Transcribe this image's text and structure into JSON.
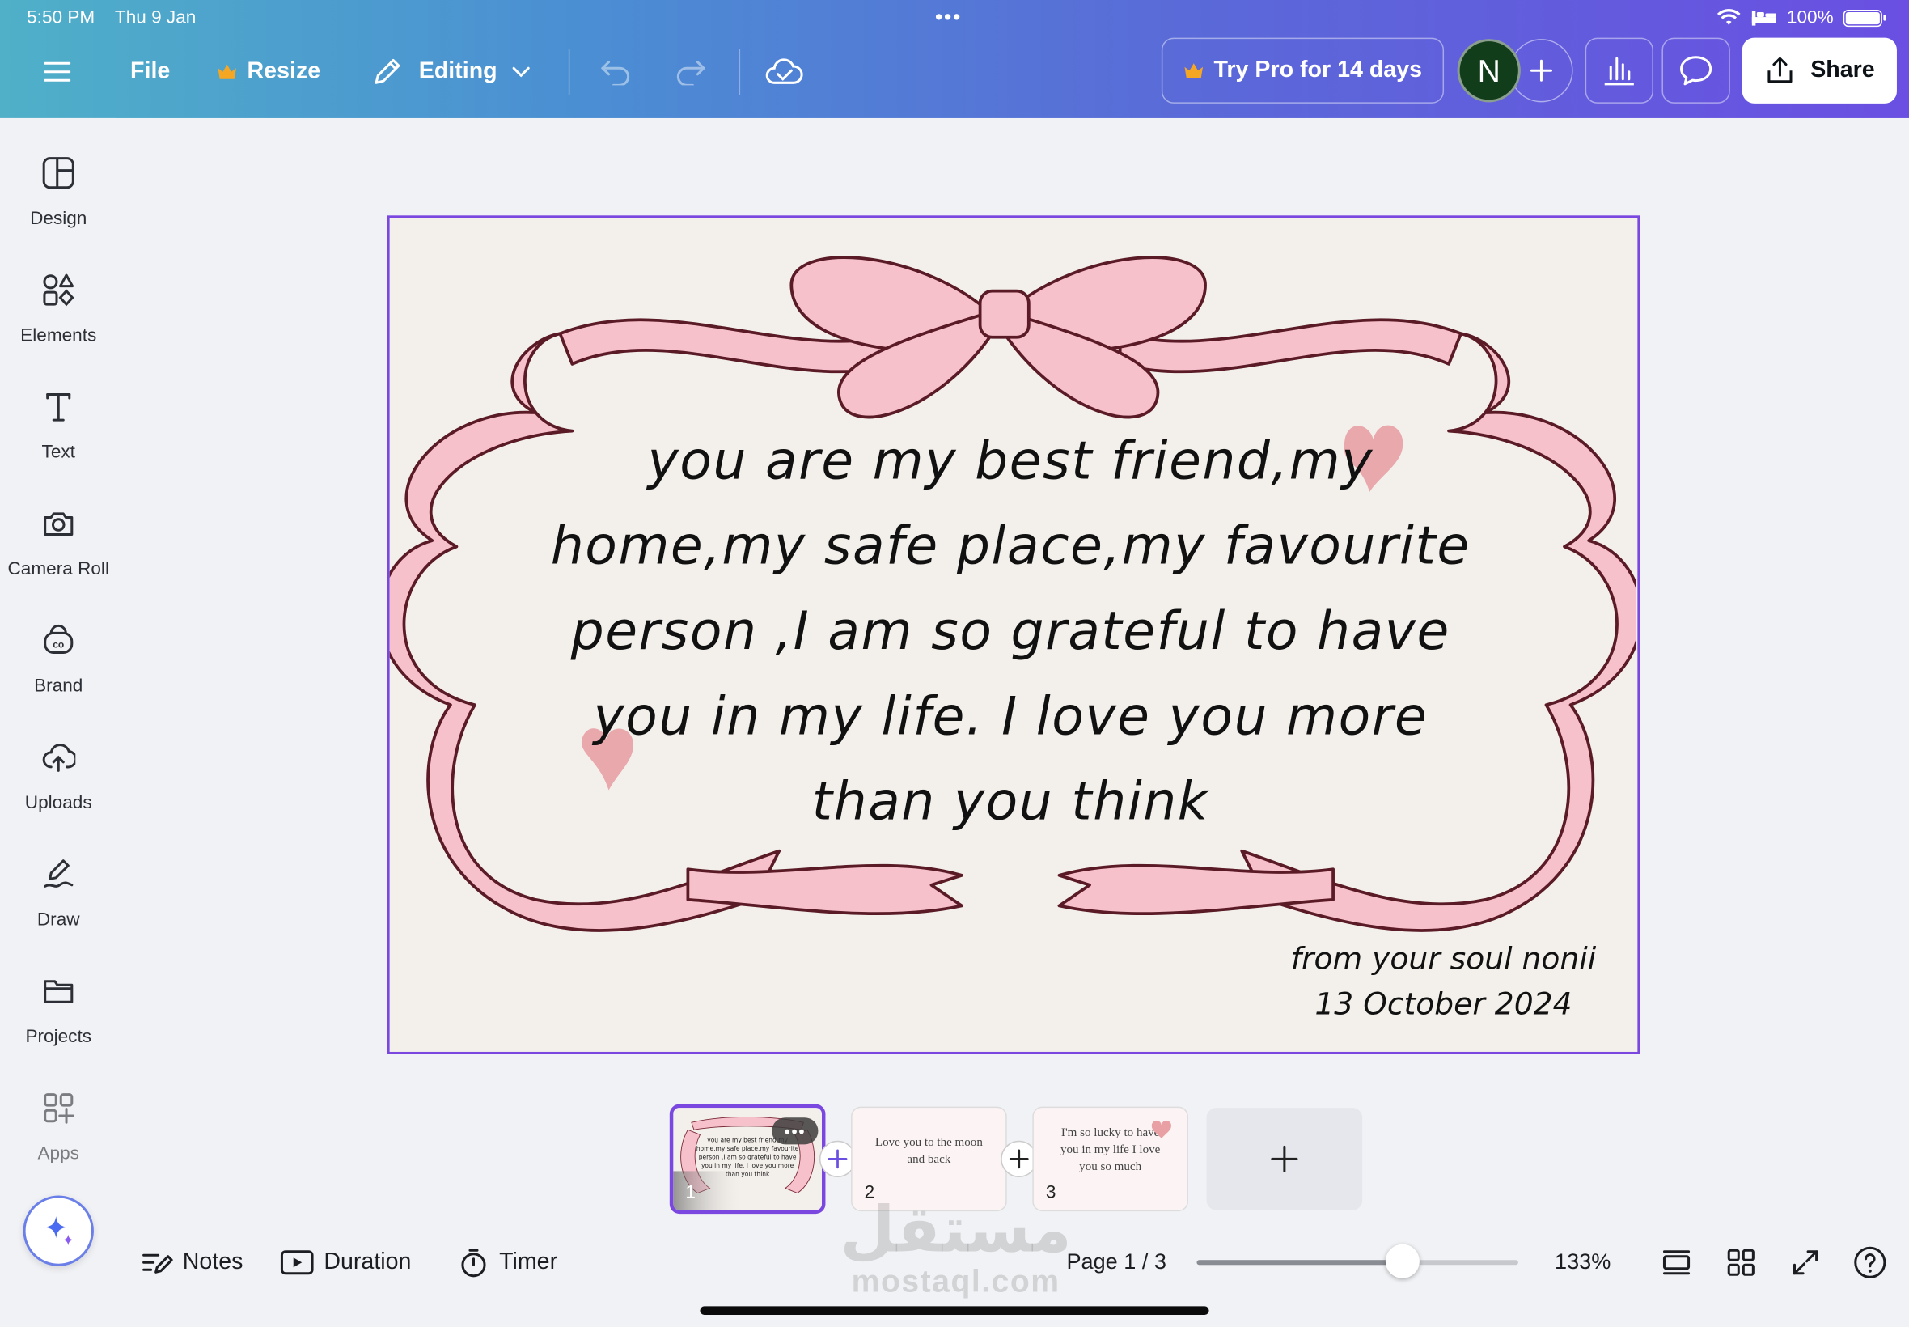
{
  "status_bar": {
    "time": "5:50 PM",
    "date": "Thu 9 Jan",
    "battery": "100%"
  },
  "toolbar": {
    "file_label": "File",
    "resize_label": "Resize",
    "editing_label": "Editing",
    "try_pro_label": "Try Pro for 14 days",
    "avatar_initial": "N",
    "share_label": "Share"
  },
  "sidebar": {
    "items": [
      {
        "label": "Design",
        "icon": "design-icon"
      },
      {
        "label": "Elements",
        "icon": "elements-icon"
      },
      {
        "label": "Text",
        "icon": "text-icon"
      },
      {
        "label": "Camera Roll",
        "icon": "camera-icon"
      },
      {
        "label": "Brand",
        "icon": "brand-icon"
      },
      {
        "label": "Uploads",
        "icon": "upload-icon"
      },
      {
        "label": "Draw",
        "icon": "draw-icon"
      },
      {
        "label": "Projects",
        "icon": "folder-icon"
      },
      {
        "label": "Apps",
        "icon": "apps-icon"
      }
    ]
  },
  "canvas": {
    "message_lines": [
      "you are my best friend,my",
      "home,my safe place,my favourite",
      "person ,I am so grateful to have",
      "you in my life. I love you more",
      "than you think"
    ],
    "from_line": "from your soul nonii",
    "date_line": "13 October 2024",
    "colors": {
      "ribbon": "#f6c1cb",
      "ribbon_outline": "#5a1a26",
      "heart": "#e8a0a4",
      "paper": "#f3f0eb",
      "selection": "#7a48e0"
    }
  },
  "pages": {
    "thumbnails": [
      {
        "number": "1",
        "active": true,
        "text": ""
      },
      {
        "number": "2",
        "active": false,
        "text": "Love you to the moon and back"
      },
      {
        "number": "3",
        "active": false,
        "text": "I'm so lucky to have you in my life I love you so much"
      }
    ]
  },
  "bottom_bar": {
    "notes_label": "Notes",
    "duration_label": "Duration",
    "timer_label": "Timer",
    "page_indicator": "Page 1 / 3",
    "zoom": "133%",
    "zoom_fraction": 0.64
  },
  "watermark": {
    "arabic": "مستقل",
    "latin": "mostaql.com"
  }
}
